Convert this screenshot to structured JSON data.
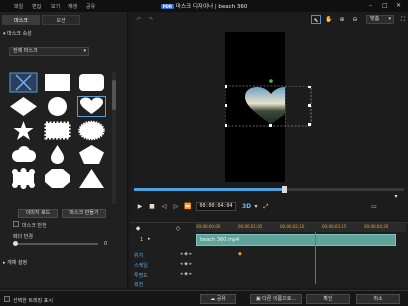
{
  "titlebar": {
    "menus": [
      "파일",
      "편집",
      "보기",
      "재생",
      "공유"
    ],
    "app_logo": "PDR",
    "title": "마스크 디자이너 | beach 360",
    "minimize": "–",
    "maximize": "□",
    "close": "✕"
  },
  "left_panel": {
    "tabs": [
      "마스크",
      "모션"
    ],
    "mask_props_title": "마스크 속성",
    "mask_category": "전체 마스크",
    "buttons": {
      "load_image": "이미지 로드",
      "make_mask": "마스크 만들기"
    },
    "invert_mask_label": "마스크 반전",
    "feather_label": "페더 반경",
    "feather_value": "0",
    "object_settings_title": "개체 설정"
  },
  "preview": {
    "zoom": "맞춤",
    "timecode": "00:00:04:04",
    "badge_3d": "3D",
    "seek_progress": 0.555
  },
  "timeline": {
    "ruler": [
      "00;00;00;00",
      "00;00;01;05",
      "00;00;02;10",
      "00;00;03;15",
      "00;00;04;20"
    ],
    "track_number": "1",
    "clip_name": "beach 360.mp4",
    "properties": [
      "위치",
      "스케일",
      "투명도",
      "회전"
    ]
  },
  "bottombar": {
    "checkbox_label": "선택한 트래킹 표시",
    "share": "공유",
    "save_as": "다른 이름으로...",
    "ok": "확인",
    "cancel": "취소"
  }
}
